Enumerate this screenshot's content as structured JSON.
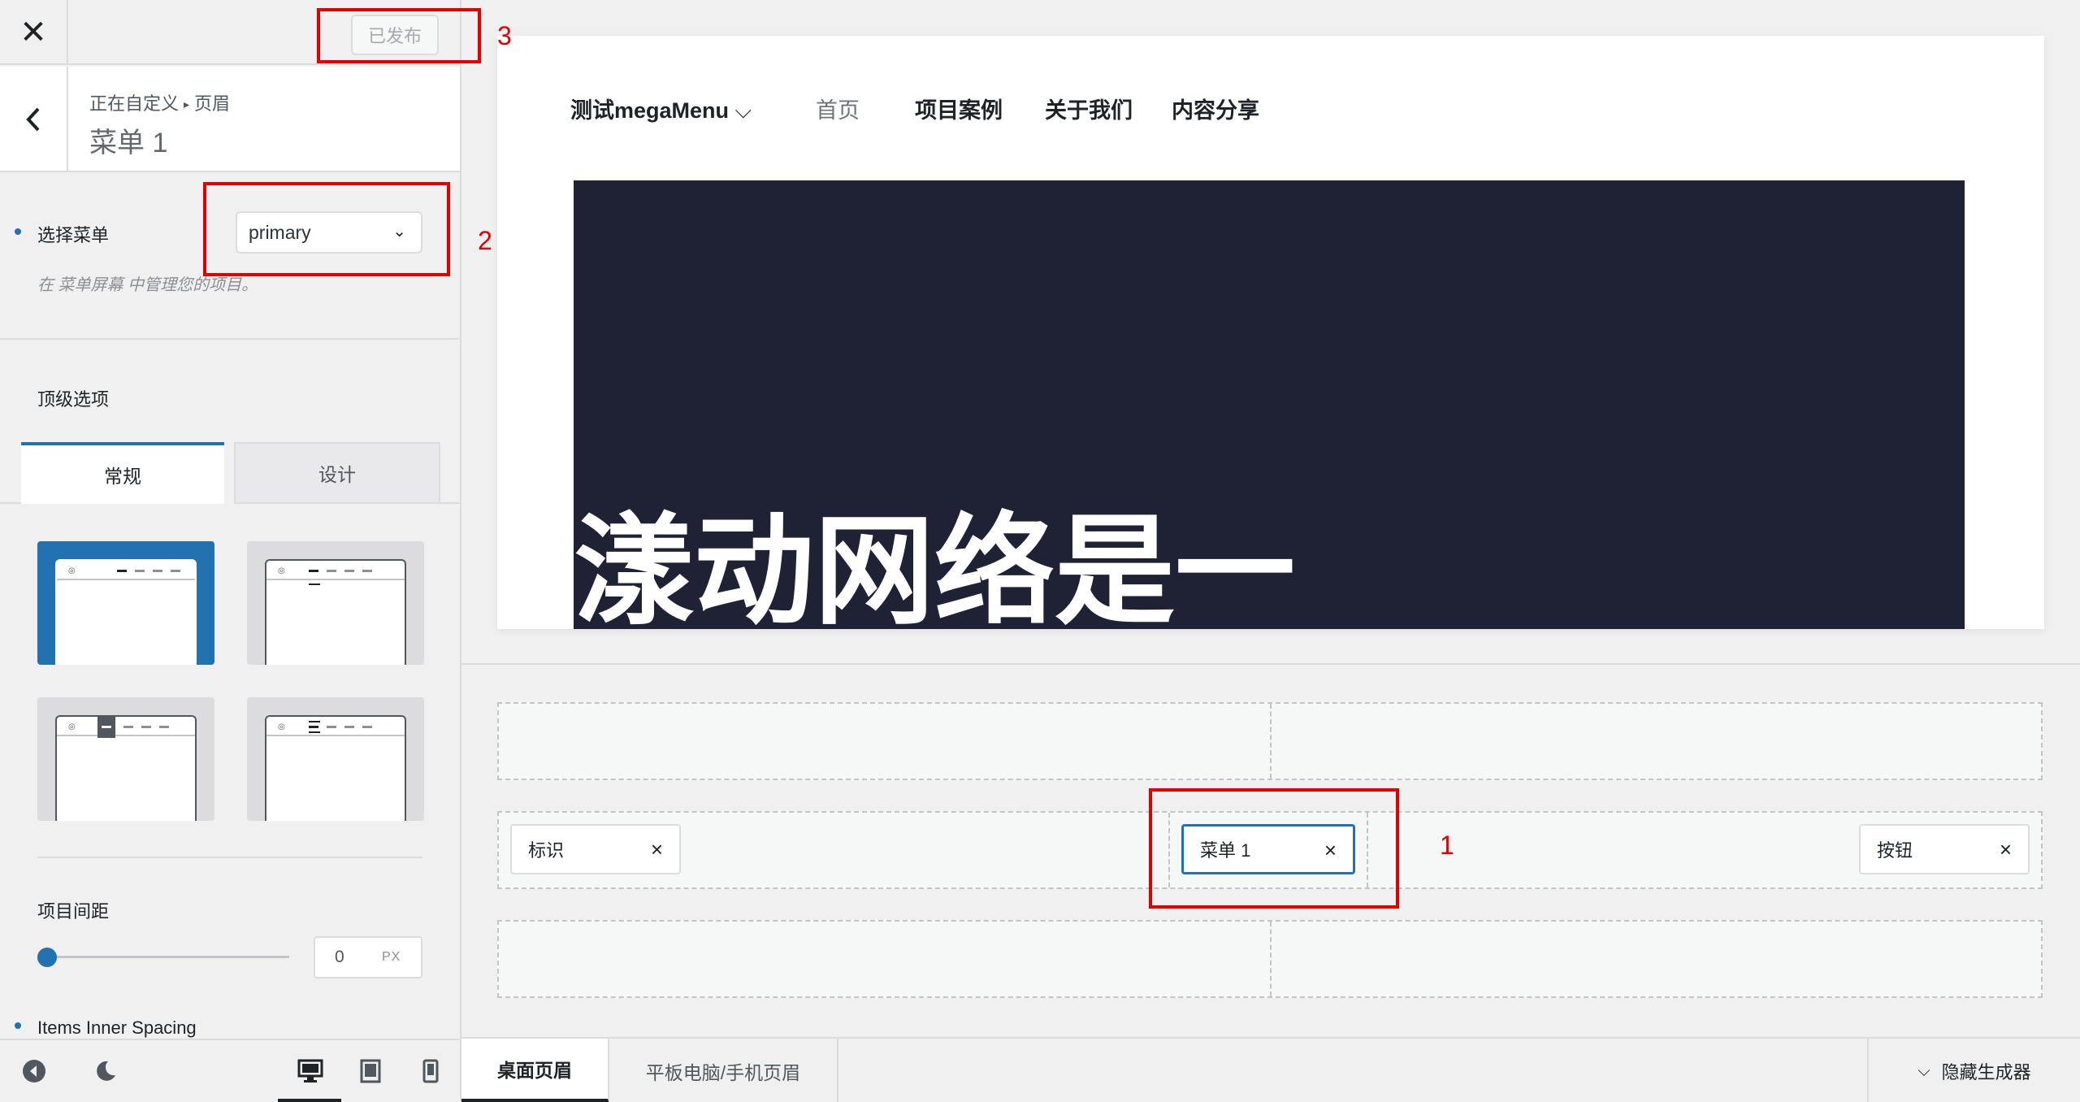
{
  "topbar": {
    "close_label": "✕",
    "publish_label": "已发布"
  },
  "section": {
    "breadcrumb_root": "正在自定义",
    "breadcrumb_sep": "▸",
    "breadcrumb_parent": "页眉",
    "title": "菜单 1"
  },
  "menu_field": {
    "label": "选择菜单",
    "selected": "primary",
    "hint": "在 菜单屏幕 中管理您的项目。"
  },
  "top_options": {
    "heading": "顶级选项",
    "tabs": [
      "常规",
      "设计"
    ]
  },
  "item_spacing": {
    "label": "项目间距",
    "value": "0",
    "unit": "PX"
  },
  "inner_spacing": {
    "label": "Items Inner Spacing"
  },
  "preview": {
    "nav": [
      "测试megaMenu",
      "首页",
      "项目案例",
      "关于我们",
      "内容分享"
    ],
    "hero_text": "漾动网络是一"
  },
  "builder": {
    "chips": {
      "logo": "标识",
      "menu": "菜单 1",
      "button": "按钮"
    },
    "remove_label": "×"
  },
  "footer": {
    "tabs": [
      "桌面页眉",
      "平板电脑/手机页眉"
    ],
    "hide_label": "隐藏生成器"
  },
  "annotations": [
    "1",
    "2",
    "3"
  ],
  "colors": {
    "accent": "#2271b1",
    "hero_bg": "#1f2135",
    "annotation": "#e00000"
  }
}
